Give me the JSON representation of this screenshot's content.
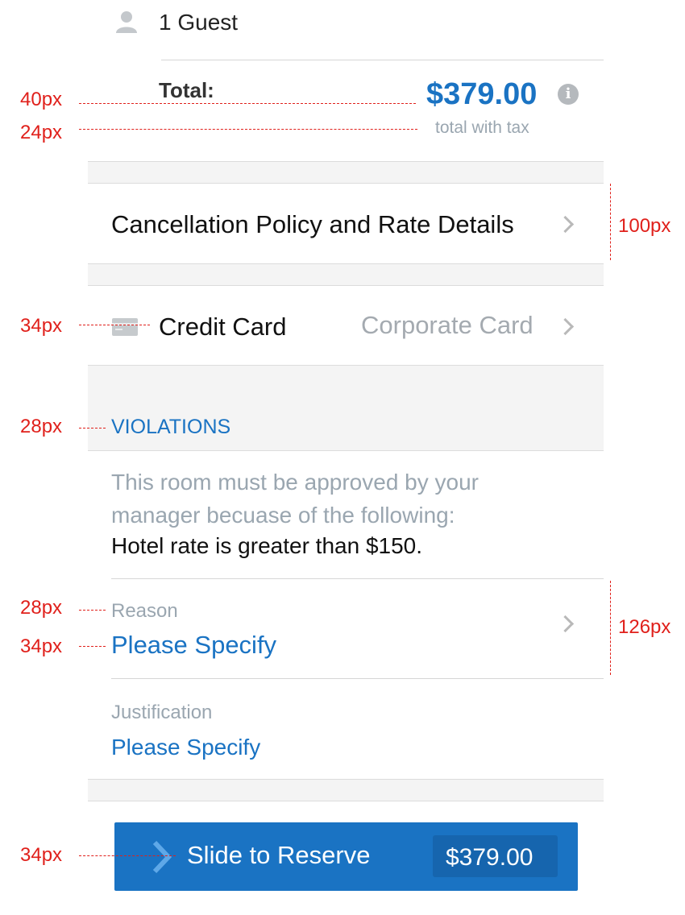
{
  "guests": {
    "label": "1 Guest",
    "icon": "person-icon"
  },
  "total": {
    "label": "Total:",
    "amount": "$379.00",
    "note": "total with tax",
    "info_icon": "info-icon"
  },
  "cancellation": {
    "label": "Cancellation Policy and Rate Details"
  },
  "payment": {
    "label": "Credit Card",
    "value": "Corporate Card",
    "icon": "credit-card-icon"
  },
  "violations": {
    "header": "VIOLATIONS",
    "message": "This room must be approved by your manager becuase of the following:",
    "detail": "Hotel rate is greater than $150."
  },
  "reason": {
    "label": "Reason",
    "value": "Please Specify"
  },
  "justification": {
    "label": "Justification",
    "value": "Please Specify"
  },
  "reserve": {
    "label": "Slide to Reserve",
    "price": "$379.00"
  },
  "annotations": {
    "a1": "40px",
    "a2": "24px",
    "a3": "100px",
    "a4": "34px",
    "a5": "28px",
    "a6": "28px",
    "a7": "34px",
    "a8": "126px",
    "a9": "34px"
  },
  "colors": {
    "accent": "#1a73c3",
    "button": "#1a73c3",
    "annotation": "#e0201b",
    "band": "#f4f4f4"
  }
}
